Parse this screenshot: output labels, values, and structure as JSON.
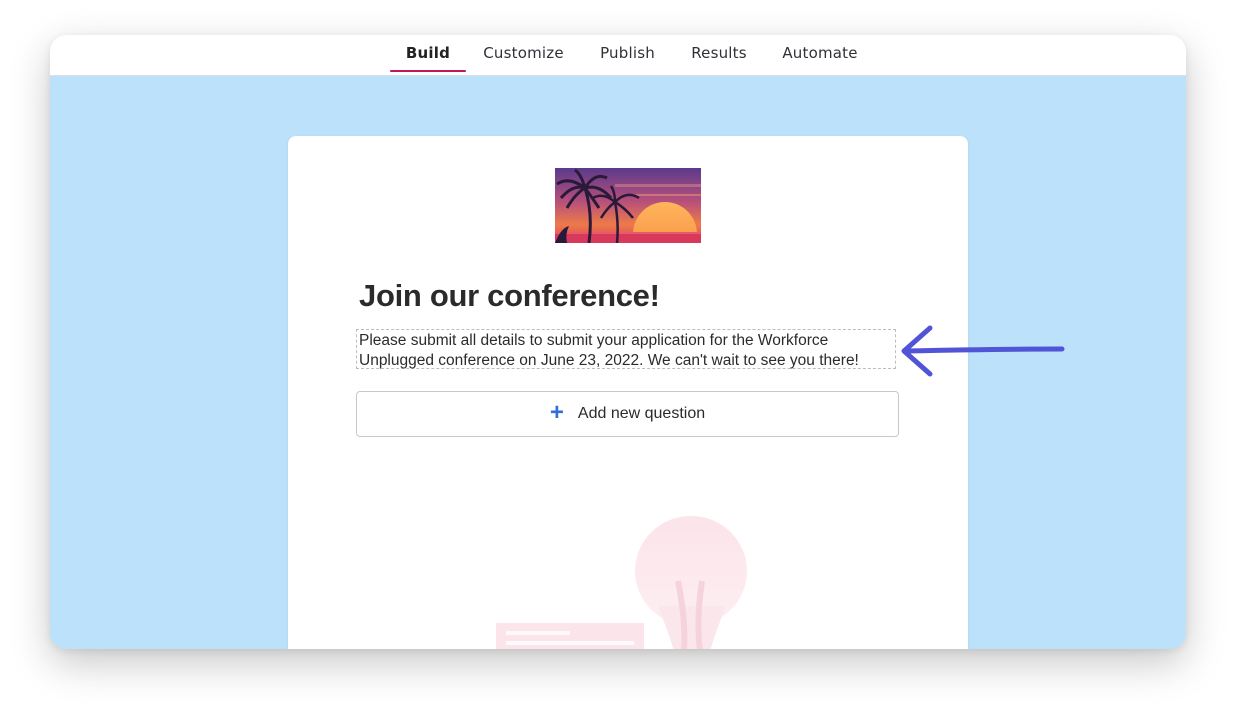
{
  "tabs": [
    {
      "label": "Build",
      "active": true
    },
    {
      "label": "Customize",
      "active": false
    },
    {
      "label": "Publish",
      "active": false
    },
    {
      "label": "Results",
      "active": false
    },
    {
      "label": "Automate",
      "active": false
    }
  ],
  "form": {
    "title": "Join our conference!",
    "description_line1": "Please submit all details to submit your application for the Workforce",
    "description_line2": "Unplugged conference on June 23, 2022. We can't wait to see you there!",
    "add_question_label": "Add new question",
    "banner_icon": "sunset-palm-image"
  },
  "colors": {
    "background": "#bbe2fa",
    "active_tab_underline": "#c2185b",
    "plus_icon": "#2f6fd6",
    "arrow": "#5154d6"
  }
}
